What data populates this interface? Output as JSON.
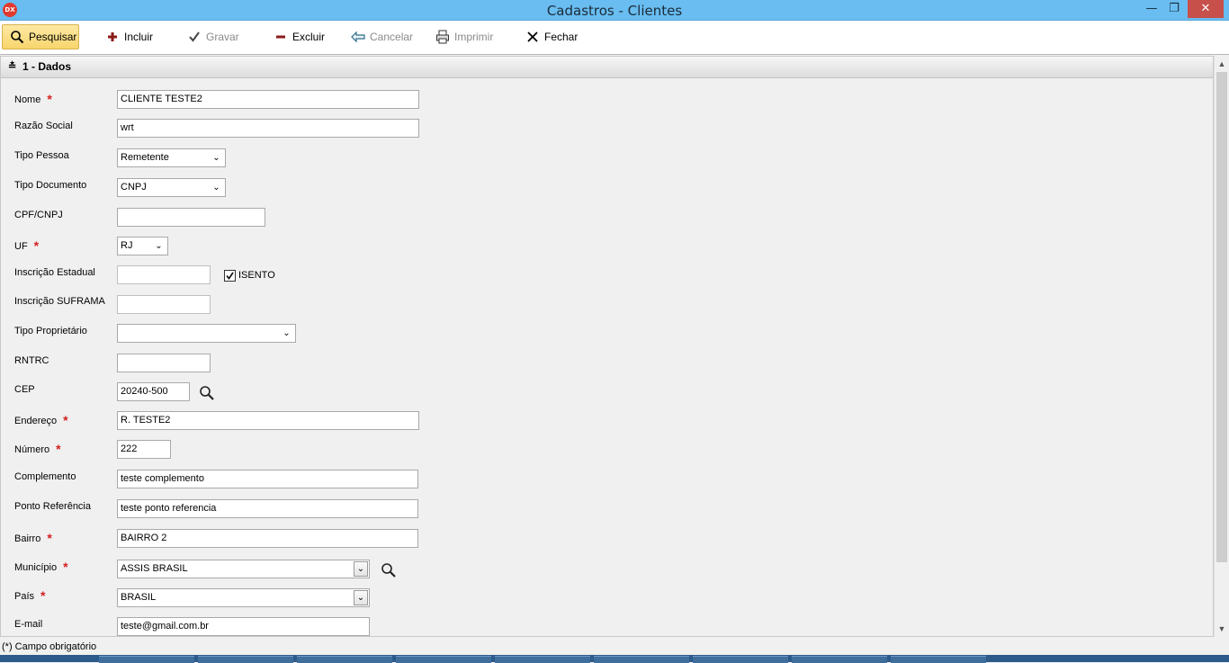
{
  "window": {
    "title": "Cadastros - Clientes",
    "app_icon_text": "DX"
  },
  "toolbar": {
    "pesquisar": "Pesquisar",
    "incluir": "Incluir",
    "gravar": "Gravar",
    "excluir": "Excluir",
    "cancelar": "Cancelar",
    "imprimir": "Imprimir",
    "fechar": "Fechar"
  },
  "section": {
    "title": "1 - Dados"
  },
  "form": {
    "nome": {
      "label": "Nome",
      "value": "CLIENTE TESTE2"
    },
    "razao_social": {
      "label": "Razão Social",
      "value": "wrt"
    },
    "tipo_pessoa": {
      "label": "Tipo Pessoa",
      "value": "Remetente"
    },
    "tipo_documento": {
      "label": "Tipo Documento",
      "value": "CNPJ"
    },
    "cpf_cnpj": {
      "label": "CPF/CNPJ",
      "value": ""
    },
    "uf": {
      "label": "UF",
      "value": "RJ"
    },
    "inscricao_estadual": {
      "label": "Inscrição Estadual",
      "value": "",
      "isento_label": "ISENTO",
      "isento_checked": true
    },
    "inscricao_suframa": {
      "label": "Inscrição SUFRAMA",
      "value": ""
    },
    "tipo_proprietario": {
      "label": "Tipo Proprietário",
      "value": ""
    },
    "rntrc": {
      "label": "RNTRC",
      "value": ""
    },
    "cep": {
      "label": "CEP",
      "value": "20240-500"
    },
    "endereco": {
      "label": "Endereço",
      "value": "R. TESTE2"
    },
    "numero": {
      "label": "Número",
      "value": "222"
    },
    "complemento": {
      "label": "Complemento",
      "value": "teste complemento"
    },
    "ponto_referencia": {
      "label": "Ponto Referência",
      "value": "teste ponto referencia"
    },
    "bairro": {
      "label": "Bairro",
      "value": "BAIRRO 2"
    },
    "municipio": {
      "label": "Município",
      "value": "ASSIS BRASIL"
    },
    "pais": {
      "label": "País",
      "value": "BRASIL"
    },
    "email": {
      "label": "E-mail",
      "value": "teste@gmail.com.br"
    }
  },
  "status": {
    "required_note": "(*) Campo obrigatório"
  },
  "colors": {
    "titlebar": "#69bdf0",
    "close_button": "#c7504b",
    "required_marker": "#d42020",
    "active_button": "#f8d56d"
  }
}
